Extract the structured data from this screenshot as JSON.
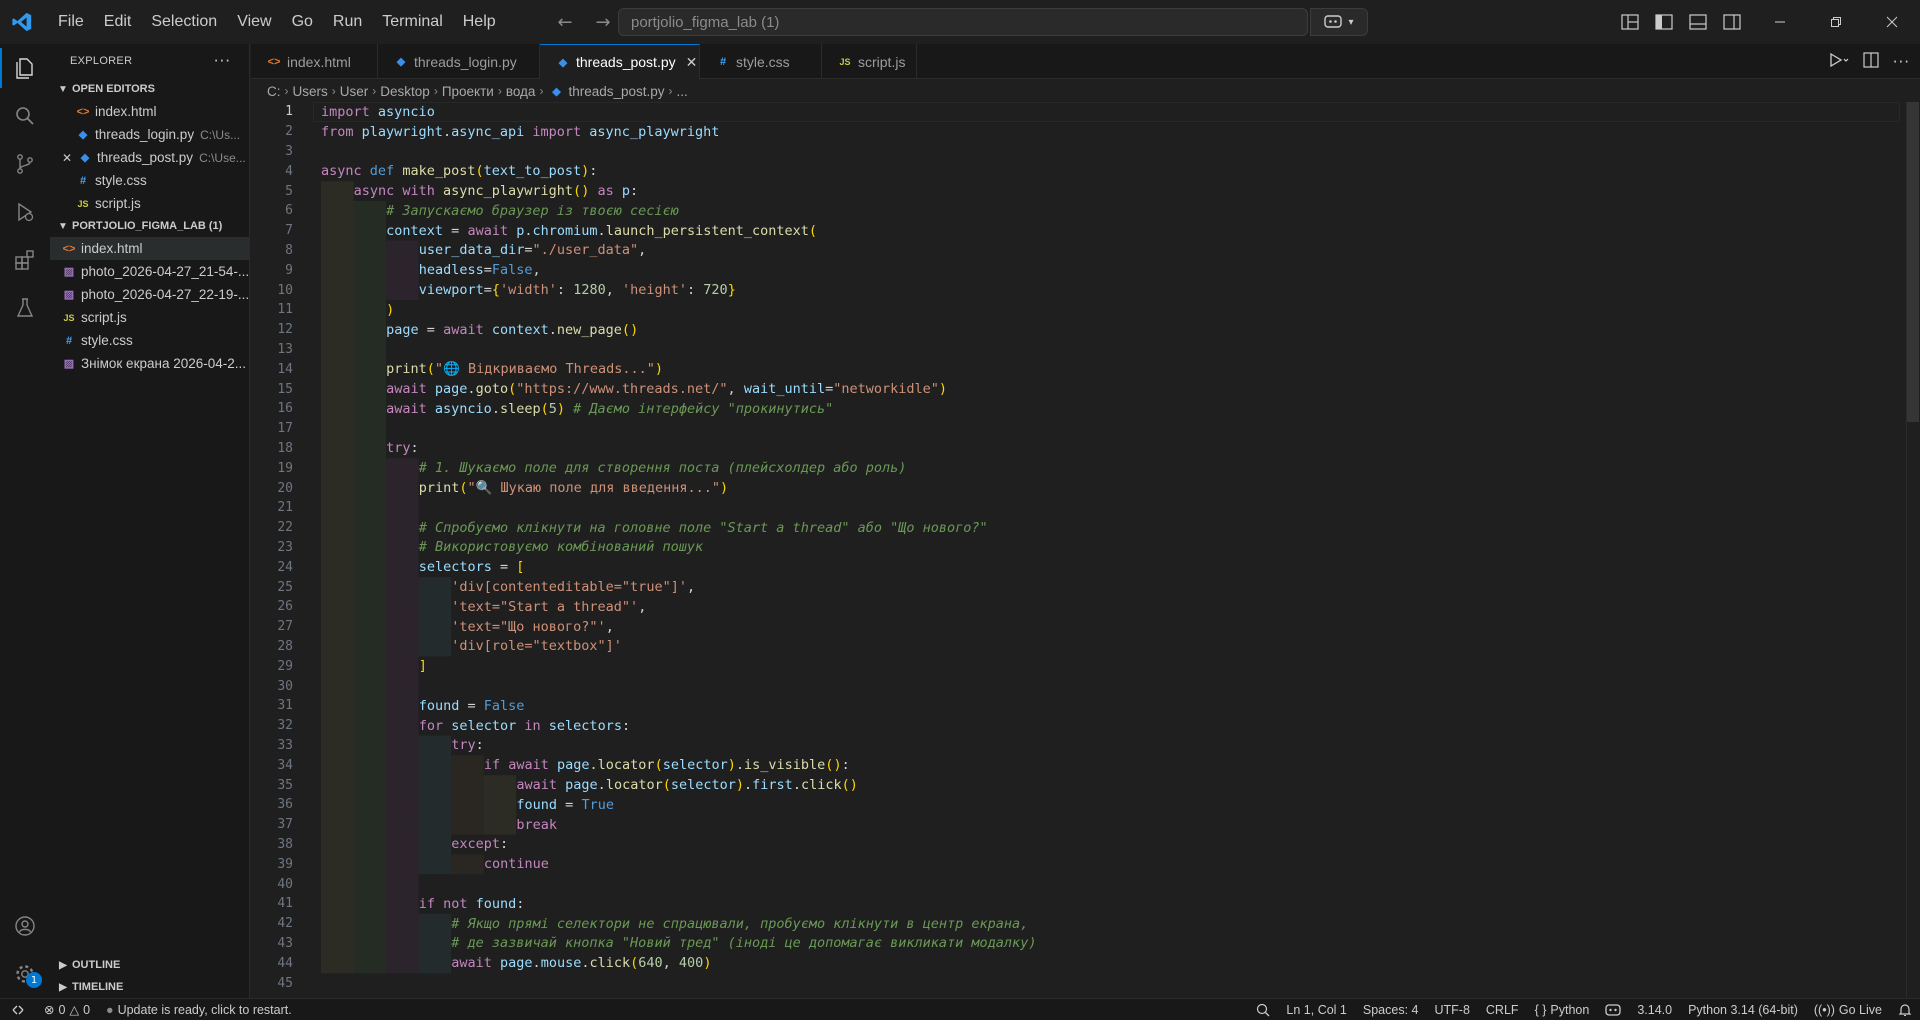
{
  "menu": [
    "File",
    "Edit",
    "Selection",
    "View",
    "Go",
    "Run",
    "Terminal",
    "Help"
  ],
  "search": {
    "value": "portjolio_figma_lab (1)"
  },
  "sidebar": {
    "title": "EXPLORER",
    "open_editors_label": "OPEN EDITORS",
    "open_editors": [
      {
        "name": "index.html",
        "type": "html",
        "path": ""
      },
      {
        "name": "threads_login.py",
        "type": "py",
        "path": "C:\\Us..."
      },
      {
        "name": "threads_post.py",
        "type": "py",
        "path": "C:\\Use..."
      },
      {
        "name": "style.css",
        "type": "css",
        "path": ""
      },
      {
        "name": "script.js",
        "type": "js",
        "path": ""
      }
    ],
    "folder_label": "PORTJOLIO_FIGMA_LAB (1)",
    "files": [
      {
        "name": "index.html",
        "type": "html"
      },
      {
        "name": "photo_2026-04-27_21-54-...",
        "type": "img"
      },
      {
        "name": "photo_2026-04-27_22-19-...",
        "type": "img"
      },
      {
        "name": "script.js",
        "type": "js"
      },
      {
        "name": "style.css",
        "type": "css"
      },
      {
        "name": "Знімок екрана 2026-04-2...",
        "type": "img"
      }
    ],
    "outline_label": "OUTLINE",
    "timeline_label": "TIMELINE"
  },
  "tabs": [
    {
      "name": "index.html",
      "type": "html"
    },
    {
      "name": "threads_login.py",
      "type": "py"
    },
    {
      "name": "threads_post.py",
      "type": "py",
      "active": true
    },
    {
      "name": "style.css",
      "type": "css"
    },
    {
      "name": "script.js",
      "type": "js"
    }
  ],
  "breadcrumbs": [
    "C:",
    "Users",
    "User",
    "Desktop",
    "Проекти",
    "вода",
    "threads_post.py",
    "..."
  ],
  "code_lines": [
    "import asyncio",
    "from playwright.async_api import async_playwright",
    "",
    "async def make_post(text_to_post):",
    "    async with async_playwright() as p:",
    "        # Запускаємо браузер із твоєю сесією",
    "        context = await p.chromium.launch_persistent_context(",
    "            user_data_dir=\"./user_data\",",
    "            headless=False,",
    "            viewport={'width': 1280, 'height': 720}",
    "        )",
    "        page = await context.new_page()",
    "",
    "        print(\"🌐 Відкриваємо Threads...\")",
    "        await page.goto(\"https://www.threads.net/\", wait_until=\"networkidle\")",
    "        await asyncio.sleep(5) # Даємо інтерфейсу \"прокинутись\"",
    "",
    "        try:",
    "            # 1. Шукаємо поле для створення поста (плейсхолдер або роль)",
    "            print(\"🔍 Шукаю поле для введення...\")",
    "",
    "            # Спробуємо клікнути на головне поле \"Start a thread\" або \"Що нового?\"",
    "            # Використовуємо комбінований пошук",
    "            selectors = [",
    "                'div[contenteditable=\"true\"]',",
    "                'text=\"Start a thread\"',",
    "                'text=\"Що нового?\"',",
    "                'div[role=\"textbox\"]'",
    "            ]",
    "",
    "            found = False",
    "            for selector in selectors:",
    "                try:",
    "                    if await page.locator(selector).is_visible():",
    "                        await page.locator(selector).first.click()",
    "                        found = True",
    "                        break",
    "                except:",
    "                    continue",
    "",
    "            if not found:",
    "                # Якщо прямі селектори не спрацювали, пробуємо клікнути в центр екрана,",
    "                # де зазвичай кнопка \"Новий тред\" (іноді це допомагає викликати модалку)",
    "                await page.mouse.click(640, 400)",
    ""
  ],
  "status": {
    "errors": "0",
    "warnings": "0",
    "message": "Update is ready, click to restart.",
    "position": "Ln 1, Col 1",
    "spaces": "Spaces: 4",
    "encoding": "UTF-8",
    "eol": "CRLF",
    "language": "Python",
    "version": "3.14.0",
    "interpreter": "Python 3.14 (64-bit)",
    "golive": "Go Live",
    "update_badge": "1"
  },
  "colors": {
    "accent": "#0078d4",
    "background": "#1f1f1f",
    "sidebar": "#181818"
  }
}
